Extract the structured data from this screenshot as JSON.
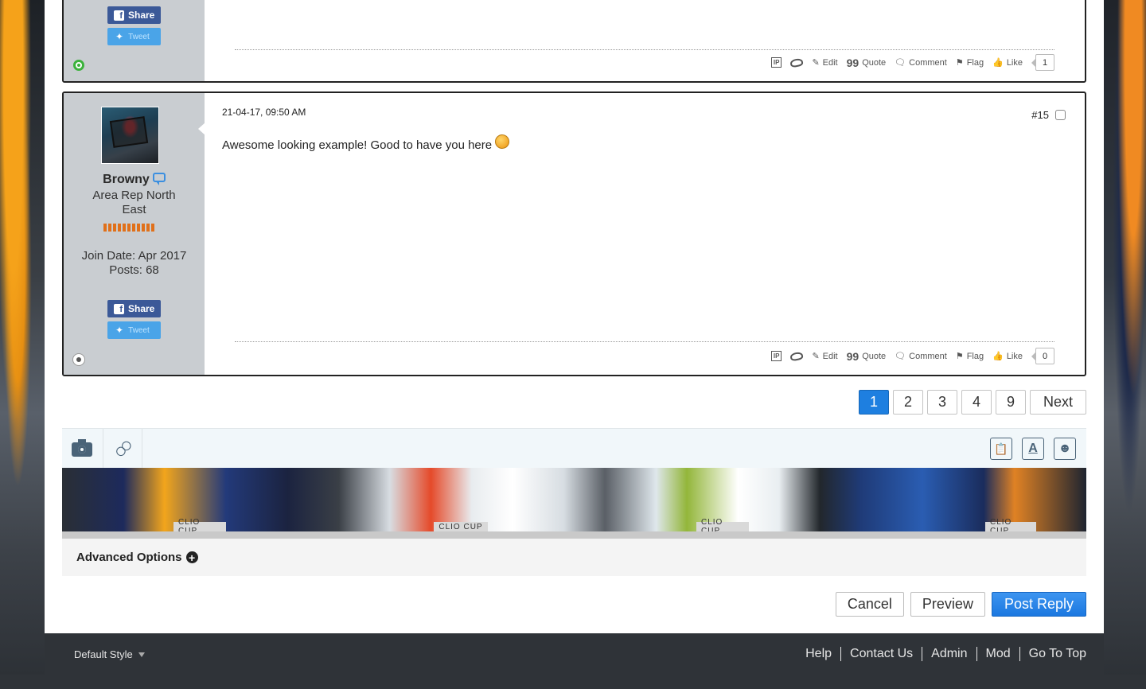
{
  "post1": {
    "share_label": "Share",
    "tweet_label": "Tweet",
    "actions": {
      "edit": "Edit",
      "quote": "Quote",
      "comment": "Comment",
      "flag": "Flag",
      "like": "Like",
      "ip": "IP"
    },
    "like_count": "1",
    "status": "online"
  },
  "post2": {
    "username": "Browny",
    "user_title": "Area Rep North East",
    "join_date": "Join Date: Apr 2017",
    "posts": "Posts: 68",
    "share_label": "Share",
    "tweet_label": "Tweet",
    "date": "21-04-17, 09:50 AM",
    "number": "#15",
    "text": "Awesome looking example! Good to have you here",
    "actions": {
      "edit": "Edit",
      "quote": "Quote",
      "comment": "Comment",
      "flag": "Flag",
      "like": "Like",
      "ip": "IP"
    },
    "like_count": "0",
    "status": "offline"
  },
  "pagination": {
    "pages": [
      "1",
      "2",
      "3",
      "4",
      "9"
    ],
    "current": "1",
    "next": "Next"
  },
  "editor": {
    "banner_labels": [
      "CLIO CUP",
      "CLIO CUP",
      "CLIO CUP",
      "CLIO CUP"
    ],
    "advanced_options": "Advanced Options",
    "tool_text_icon": "A"
  },
  "form_buttons": {
    "cancel": "Cancel",
    "preview": "Preview",
    "post_reply": "Post Reply"
  },
  "footer": {
    "style": "Default Style",
    "links": [
      "Help",
      "Contact Us",
      "Admin",
      "Mod",
      "Go To Top"
    ]
  },
  "colors": {
    "accent": "#1e7fe0",
    "facebook": "#3b5998",
    "twitter": "#4aa4e8",
    "footer_bg": "#2f3338",
    "user_panel": "#c9cdd1"
  }
}
